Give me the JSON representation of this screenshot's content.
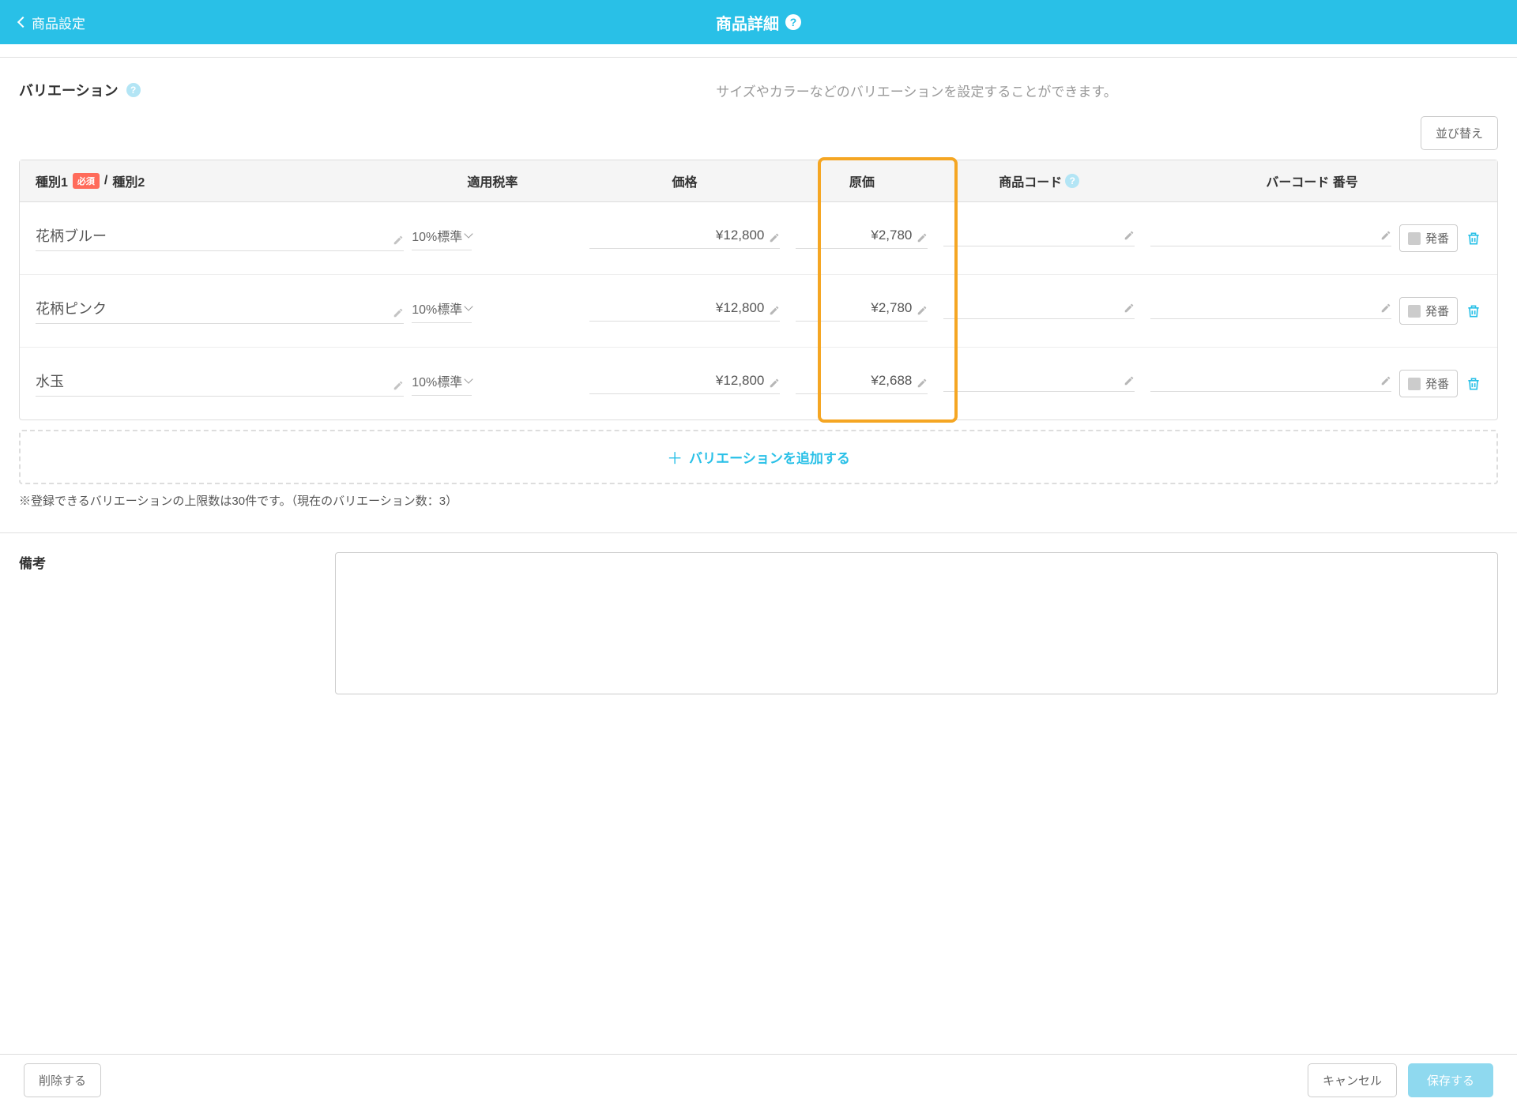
{
  "header": {
    "back_label": "商品設定",
    "title": "商品詳細"
  },
  "section": {
    "label": "バリエーション",
    "description": "サイズやカラーなどのバリエーションを設定することができます。",
    "sort_button": "並び替え"
  },
  "columns": {
    "type1": "種別1",
    "type2": "種別2",
    "required": "必須",
    "tax": "適用税率",
    "price": "価格",
    "cost": "原価",
    "code": "商品コード",
    "barcode": "バーコード 番号",
    "type_separator": " / "
  },
  "rows": [
    {
      "name": "花柄ブルー",
      "tax": "10%標準",
      "price": "¥12,800",
      "cost": "¥2,780",
      "code": "",
      "barcode": "",
      "issue": "発番"
    },
    {
      "name": "花柄ピンク",
      "tax": "10%標準",
      "price": "¥12,800",
      "cost": "¥2,780",
      "code": "",
      "barcode": "",
      "issue": "発番"
    },
    {
      "name": "水玉",
      "tax": "10%標準",
      "price": "¥12,800",
      "cost": "¥2,688",
      "code": "",
      "barcode": "",
      "issue": "発番"
    }
  ],
  "add_row": "バリエーションを追加する",
  "limit_note": "※登録できるバリエーションの上限数は30件です。（現在のバリエーション数：3）",
  "remarks": {
    "label": "備考",
    "value": ""
  },
  "footer": {
    "delete": "削除する",
    "cancel": "キャンセル",
    "save": "保存する"
  }
}
